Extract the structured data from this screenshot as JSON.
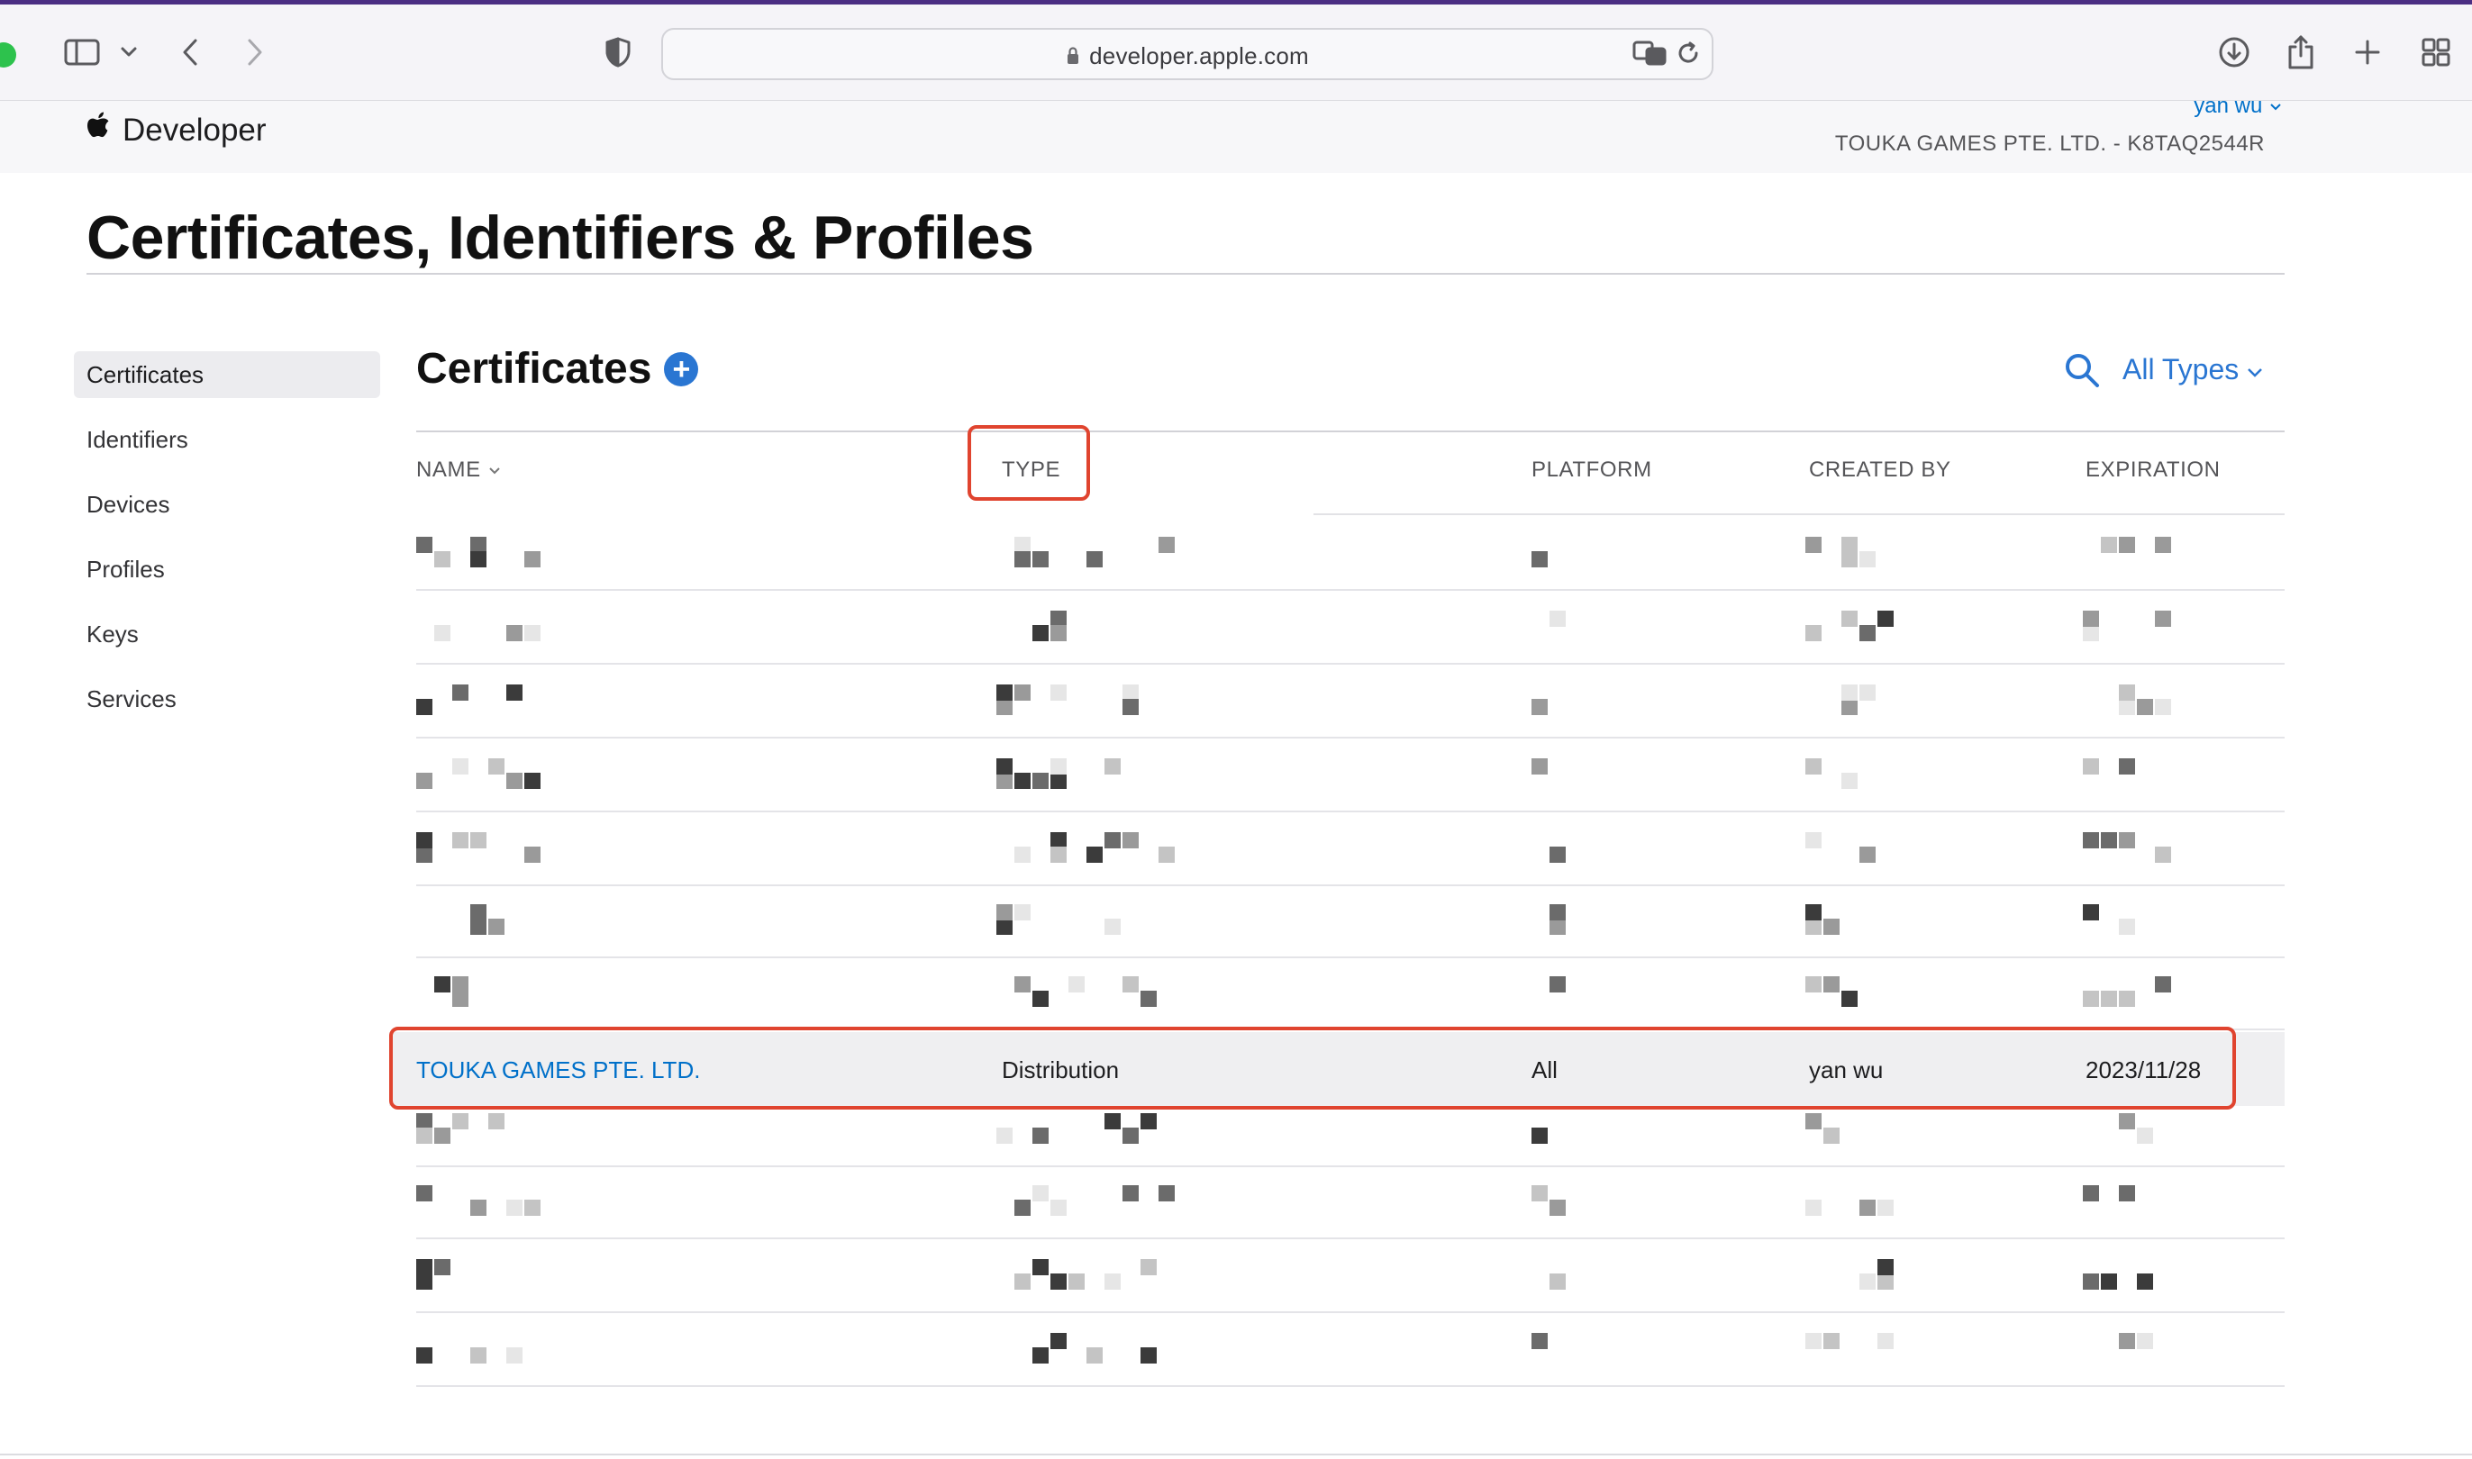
{
  "browser": {
    "url": "developer.apple.com"
  },
  "header": {
    "brand": "Developer",
    "user": "yan wu",
    "team": "TOUKA GAMES PTE. LTD. - K8TAQ2544R"
  },
  "page_title": "Certificates, Identifiers & Profiles",
  "sidebar": {
    "items": [
      {
        "label": "Certificates",
        "active": true
      },
      {
        "label": "Identifiers"
      },
      {
        "label": "Devices"
      },
      {
        "label": "Profiles"
      },
      {
        "label": "Keys"
      },
      {
        "label": "Services"
      }
    ]
  },
  "section": {
    "title": "Certificates",
    "filter": "All Types"
  },
  "table": {
    "columns": [
      "NAME",
      "TYPE",
      "PLATFORM",
      "CREATED BY",
      "EXPIRATION"
    ],
    "highlighted_row": {
      "name": "TOUKA GAMES PTE. LTD.",
      "type": "Distribution",
      "platform": "All",
      "created_by": "yan wu",
      "expiration": "2023/11/28"
    }
  },
  "colors": {
    "accent": "#2a76d2",
    "link": "#0070c9",
    "annotation": "#e0442f"
  }
}
